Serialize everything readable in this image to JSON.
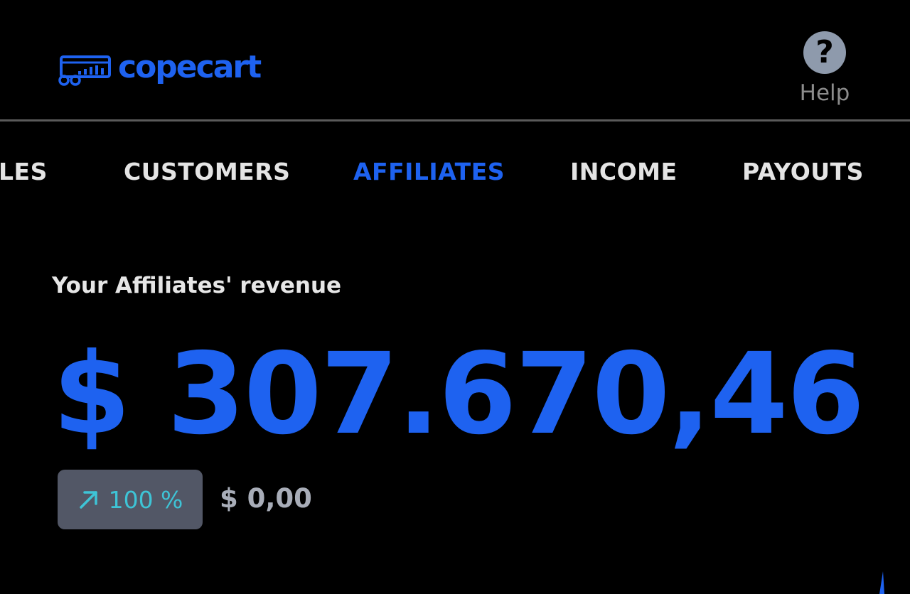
{
  "brand": {
    "name": "copecart",
    "logo_icon": "cart-chart-icon",
    "color": "#1e62f0"
  },
  "header": {
    "help_icon": "question-circle-icon",
    "help_label": "Help"
  },
  "tabs": [
    {
      "label": "LES",
      "active": false
    },
    {
      "label": "CUSTOMERS",
      "active": false
    },
    {
      "label": "AFFILIATES",
      "active": true
    },
    {
      "label": "INCOME",
      "active": false
    },
    {
      "label": "PAYOUTS",
      "active": false
    }
  ],
  "revenue": {
    "label": "Your Affiliates' revenue",
    "amount": "$ 307.670,46",
    "change_icon": "arrow-up-right-icon",
    "change_percent": "100 %",
    "previous_value": "$ 0,00"
  },
  "colors": {
    "accent": "#1e62f0",
    "background": "#000000",
    "badge_bg": "#525766",
    "badge_text": "#3ec4d6"
  }
}
